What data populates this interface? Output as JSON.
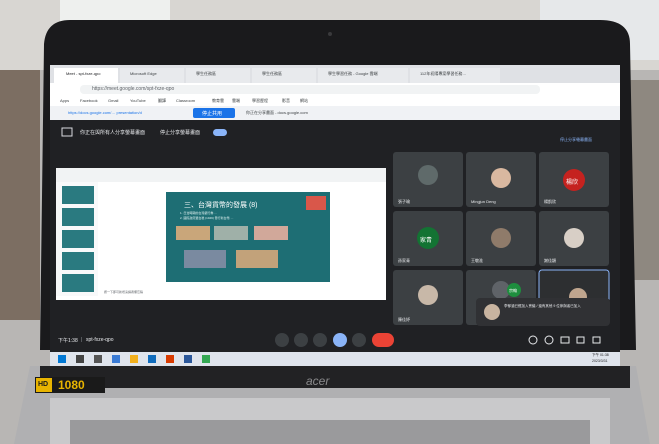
{
  "browser": {
    "tabs": [
      {
        "label": "Meet - spt-fxze-qpo"
      },
      {
        "label": "Microsoft Edge"
      },
      {
        "label": "學生任務區"
      },
      {
        "label": "學生任務區"
      },
      {
        "label": "學生學習任務 - Google 雲端"
      },
      {
        "label": "112年初陽專案學習任務…"
      }
    ],
    "url": "https://meet.google.com/spt-fxze-qpo",
    "bookmarks": [
      "Apps",
      "Facebook",
      "Gmail",
      "YouTube",
      "翻譯",
      "Classroom",
      "教育雲",
      "雲端",
      "學習歷程",
      "影音",
      "網站"
    ],
    "share_bar": {
      "link_text": "https://docs.google.com/… presentation/d",
      "stop_button": "停止共用",
      "info_text": "你正在分享畫面 - docs.google.com"
    }
  },
  "meet": {
    "presenting_banner": "你正在與所有人分享螢幕畫面",
    "stop_presenting": "停止分享螢幕畫面",
    "banner_right": "停止分享螢幕畫面",
    "slide": {
      "title": "三、台灣貨幣的發展 (8)",
      "lines": [
        "1. 日治時期的台灣銀行券 …",
        "2. 國民政府遷台後 (1949) 發行新台幣 …"
      ],
      "caption": "按一下即可新增演講者備忘稿"
    },
    "participants": [
      {
        "name": "張子瑜",
        "initials": ""
      },
      {
        "name": "Mingjun Deng",
        "initials": ""
      },
      {
        "name": "楊凱欣",
        "initials": "楊欣"
      },
      {
        "name": "孫家青",
        "initials": "家青"
      },
      {
        "name": "王敬淮",
        "initials": ""
      },
      {
        "name": "謝佳穎",
        "initials": ""
      },
      {
        "name": "陳佳妤",
        "initials": ""
      },
      {
        "name": "",
        "initials": "宗翰"
      },
      {
        "name": "",
        "initials": ""
      }
    ],
    "notification": "李郁涵已經加入會議 / 還有其他 9 位參與者已加入",
    "meeting_time": "下午1:38",
    "meeting_code": "spt-fxze-qpo",
    "controls": [
      "mic",
      "camera",
      "raise-hand",
      "present",
      "more",
      "leave"
    ]
  },
  "taskbar": {
    "clock": "下午 01:38",
    "date": "2023/3/31"
  },
  "camera_overlay": {
    "badge_hd": "HD",
    "resolution": "1080"
  },
  "laptop": {
    "brand": "acer"
  },
  "colors": {
    "meet_bg": "#202124",
    "teal_slide": "#1e6e74",
    "blue_accent": "#8ab4f8",
    "leave_red": "#ea4335",
    "hd_badge": "#e8b400"
  }
}
